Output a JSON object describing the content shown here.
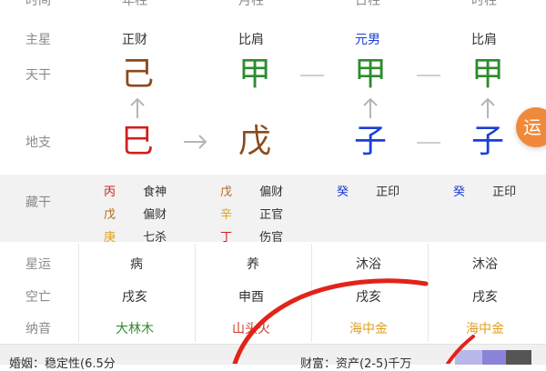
{
  "header": {
    "row_label": "时间",
    "columns": [
      "年柱",
      "月柱",
      "日柱",
      "时柱"
    ]
  },
  "rows": {
    "zhuxing": {
      "label": "主星",
      "values": [
        "正财",
        "比肩",
        "元男",
        "比肩"
      ]
    },
    "tiangan": {
      "label": "天干",
      "values": [
        "己",
        "甲",
        "甲",
        "甲"
      ],
      "colors": [
        "#8b4a1c",
        "#2e8b2e",
        "#2e8b2e",
        "#2e8b2e"
      ]
    },
    "dizhi": {
      "label": "地支",
      "values": [
        "巳",
        "戊",
        "子",
        "子"
      ],
      "colors": [
        "#d11f1f",
        "#8b4a1c",
        "#1a3fd6",
        "#1a3fd6"
      ]
    },
    "canggan": {
      "label": "藏干",
      "columns": [
        [
          {
            "stem": "丙",
            "stem_color": "#d11f1f",
            "god": "食神"
          },
          {
            "stem": "戊",
            "stem_color": "#b5651d",
            "god": "偏财"
          },
          {
            "stem": "庚",
            "stem_color": "#e0a020",
            "god": "七杀"
          }
        ],
        [
          {
            "stem": "戊",
            "stem_color": "#b5651d",
            "god": "偏财"
          },
          {
            "stem": "辛",
            "stem_color": "#e0a020",
            "god": "正官"
          },
          {
            "stem": "丁",
            "stem_color": "#d11f1f",
            "god": "伤官"
          }
        ],
        [
          {
            "stem": "癸",
            "stem_color": "#1a3fd6",
            "god": "正印"
          }
        ],
        [
          {
            "stem": "癸",
            "stem_color": "#1a3fd6",
            "god": "正印"
          }
        ]
      ]
    },
    "xingyun": {
      "label": "星运",
      "values": [
        "病",
        "养",
        "沐浴",
        "沐浴"
      ]
    },
    "kongwang": {
      "label": "空亡",
      "values": [
        "戌亥",
        "申酉",
        "戌亥",
        "戌亥"
      ]
    },
    "nayin": {
      "label": "纳音",
      "values": [
        "大林木",
        "山头火",
        "海中金",
        "海中金"
      ],
      "colors": [
        "#2e8b2e",
        "#d33a2a",
        "#e0a020",
        "#e0a020"
      ]
    }
  },
  "float_button": {
    "label": "运",
    "color": "#f08a3a"
  },
  "bottom": {
    "left": "婚姻：稳定性(6.5分",
    "right": "财富：资产(2-5)千万"
  },
  "colors": {
    "label_gray": "#8a8a8a",
    "band_gray": "#f2f2f2",
    "annotation_red": "#e2231a"
  }
}
